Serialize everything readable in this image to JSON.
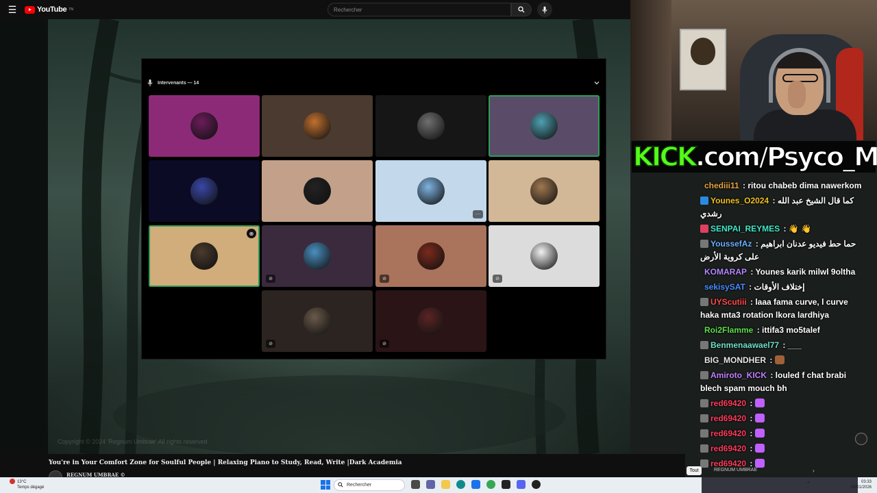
{
  "youtube": {
    "logo_text": "YouTube",
    "logo_sup": "TN",
    "search_placeholder": "Rechercher"
  },
  "voice_panel": {
    "header": "Intervenants — 14",
    "tiles": [
      {
        "bg": "#8d2a78",
        "avatar": "#6b1c5a",
        "speaking": false,
        "muted": false
      },
      {
        "bg": "#4a3a30",
        "avatar": "#c07030",
        "speaking": false,
        "muted": false
      },
      {
        "bg": "#161616",
        "avatar": "#6f6f6f",
        "speaking": false,
        "muted": false
      },
      {
        "bg": "#5a4c68",
        "avatar": "#4f9fb0",
        "speaking": true,
        "muted": false
      },
      {
        "bg": "#0b0b26",
        "avatar": "#3a47a8",
        "speaking": false,
        "muted": false
      },
      {
        "bg": "#c2a08a",
        "avatar": "#222222",
        "speaking": false,
        "muted": false
      },
      {
        "bg": "#c3d8ea",
        "avatar": "#7fb2e0",
        "speaking": false,
        "muted": false,
        "more": "···"
      },
      {
        "bg": "#d2b896",
        "avatar": "#a07850",
        "speaking": false,
        "muted": false
      },
      {
        "bg": "#d0ad7a",
        "avatar": "#4a3a2c",
        "speaking": true,
        "muted": false,
        "pin": "⊕"
      },
      {
        "bg": "#3b2a3d",
        "avatar": "#4a8fc0",
        "speaking": false,
        "muted": true
      },
      {
        "bg": "#a9735c",
        "avatar": "#7a2a1c",
        "speaking": false,
        "muted": true
      },
      {
        "bg": "#dcdcdc",
        "avatar": "#f2f2f2",
        "speaking": false,
        "muted": true
      },
      {
        "bg": "#2c2421",
        "avatar": "#6a5a4a",
        "speaking": false,
        "muted": true
      },
      {
        "bg": "#2a1416",
        "avatar": "#5a2424",
        "speaking": false,
        "muted": true
      }
    ]
  },
  "video": {
    "copyright": "Copyright © 2024 'Regnum Umbrae' All rights reserved",
    "title": "You're in Your Comfort Zone for Soulful People | Relaxing Piano to Study, Read, Write |Dark Academia",
    "channel": "REGNUM UMBRAE ©"
  },
  "kick_banner": {
    "brand": "KICK",
    "rest": ".com/Psyco_M"
  },
  "chat": [
    {
      "user": "chediii11",
      "color": "#e8a33d",
      "text": ": ritou chabeb dima nawerkom",
      "badge": ""
    },
    {
      "user": "Younes_O2024",
      "color": "#f0c020",
      "text": ": كما قال الشيخ عبد الله رشدي",
      "badge": "#2a8ae0"
    },
    {
      "user": "SENPAI_REYMES",
      "color": "#41e8c8",
      "text": ": 👋 👋",
      "badge": "#e04060"
    },
    {
      "user": "YoussefAz",
      "color": "#6ab0ff",
      "text": ": حما حط فيديو عدنان ابراهيم على كروية الأرض",
      "badge": "#777777"
    },
    {
      "user": "KOMARAP",
      "color": "#b488ff",
      "text": ": Younes karik milwl 9oltha",
      "badge": ""
    },
    {
      "user": "sekisySAT",
      "color": "#4a8cff",
      "text": ": إختلاف الأوقات",
      "badge": ""
    },
    {
      "user": "UYScutiii",
      "color": "#ff4a4a",
      "text": ": laaa fama curve, l curve haka mta3 rotation lkora lardhiya",
      "badge": "#777777"
    },
    {
      "user": "Roi2Flamme",
      "color": "#5de04a",
      "text": ": ittifa3 mo5talef",
      "badge": ""
    },
    {
      "user": "Benmenaawael77",
      "color": "#6fe0c8",
      "text": ": ___",
      "badge": "#777777"
    },
    {
      "user": "BIG_MONDHER",
      "color": "#e8e8e8",
      "text": ":",
      "badge": "",
      "emote": "#a0603a"
    },
    {
      "user": "Amiroto_KICK",
      "color": "#c080ff",
      "text": ": louled f chat brabi blech spam mouch bh",
      "badge": "#777777"
    },
    {
      "user": "red69420",
      "color": "#ff3b5c",
      "text": ":",
      "badge": "#777777",
      "emote": "#c060ff"
    },
    {
      "user": "red69420",
      "color": "#ff3b5c",
      "text": ":",
      "badge": "#777777",
      "emote": "#c060ff"
    },
    {
      "user": "red69420",
      "color": "#ff3b5c",
      "text": ":",
      "badge": "#777777",
      "emote": "#c060ff"
    },
    {
      "user": "red69420",
      "color": "#ff3b5c",
      "text": ":",
      "badge": "#777777",
      "emote": "#c060ff"
    },
    {
      "user": "red69420",
      "color": "#ff3b5c",
      "text": ":",
      "badge": "#777777",
      "emote": "#c060ff"
    }
  ],
  "bottom_controls": {
    "filter_chip": "Tout",
    "ticker": "REGNUM UMBRAE"
  },
  "taskbar": {
    "temperature": "13°C",
    "weather": "Temps dégagé",
    "search_placeholder": "Rechercher",
    "time": "03:33",
    "date": "03/01/2026",
    "icons": [
      "file-explorer-icon",
      "chat-icon",
      "folder-icon",
      "edge-icon",
      "mail-icon",
      "chrome-icon",
      "terminal-icon",
      "discord-icon",
      "obs-icon"
    ]
  },
  "colors": {
    "speaking_outline": "#2e9d59",
    "kick_green": "#53fc18",
    "youtube_red": "#ff0000"
  }
}
